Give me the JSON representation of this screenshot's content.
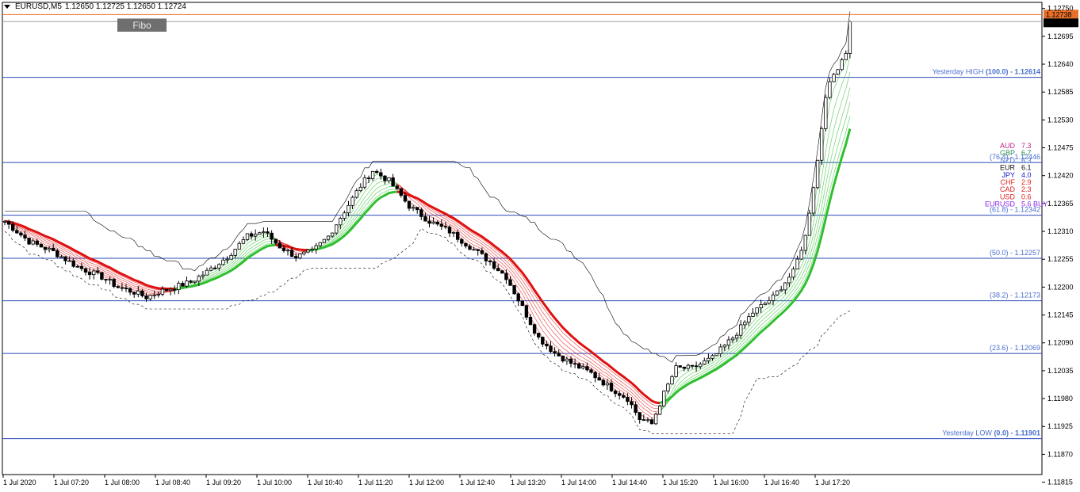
{
  "header": {
    "symbol": "EURUSD,M5",
    "ohlc": "1.12650 1.12725 1.12650 1.12724"
  },
  "fibo_button": "Fibo",
  "price_tags": {
    "ask": "1.12738",
    "bid": "1.12724",
    "ask_color": "#e8702a",
    "bid_color": "#000000"
  },
  "currency_strength": [
    {
      "cur": "AUD",
      "val": "7.3",
      "color": "#c0248c"
    },
    {
      "cur": "GBP",
      "val": "6.7",
      "color": "#2e8b57"
    },
    {
      "cur": "NZD",
      "val": "6.3",
      "color": "#4a6fd0"
    },
    {
      "cur": "EUR",
      "val": "6.1",
      "color": "#111111"
    },
    {
      "cur": "JPY",
      "val": "4.0",
      "color": "#1515c8"
    },
    {
      "cur": "CHF",
      "val": "2.9",
      "color": "#e02020"
    },
    {
      "cur": "CAD",
      "val": "2.3",
      "color": "#e02020"
    },
    {
      "cur": "USD",
      "val": "0.6",
      "color": "#e02020"
    },
    {
      "cur": "EURUSD",
      "val": "5.6 BUY",
      "color": "#8a2be2"
    }
  ],
  "chart_data": {
    "type": "candlestick",
    "symbol": "EURUSD",
    "timeframe": "M5",
    "y_range": [
      1.1183,
      1.12762
    ],
    "y_ticks": [
      "1.12750",
      "1.12695",
      "1.12640",
      "1.12585",
      "1.12530",
      "1.12475",
      "1.12420",
      "1.12365",
      "1.12310",
      "1.12255",
      "1.12200",
      "1.12145",
      "1.12090",
      "1.12035",
      "1.11980",
      "1.11925",
      "1.11870",
      "1.11815"
    ],
    "x_ticks": [
      "1 Jul 2020",
      "1 Jul 07:20",
      "1 Jul 08:00",
      "1 Jul 08:40",
      "1 Jul 09:20",
      "1 Jul 10:00",
      "1 Jul 10:40",
      "1 Jul 11:20",
      "1 Jul 12:00",
      "1 Jul 12:40",
      "1 Jul 13:20",
      "1 Jul 14:00",
      "1 Jul 14:40",
      "1 Jul 15:20",
      "1 Jul 16:00",
      "1 Jul 16:40",
      "1 Jul 17:20"
    ],
    "fib_levels": [
      {
        "label": "Yesterday HIGH",
        "pct": "(100.0)",
        "price": "1.12614",
        "value": 1.12614
      },
      {
        "label": "",
        "pct": "(76.4)",
        "price": "1.12446",
        "value": 1.12446
      },
      {
        "label": "",
        "pct": "(61.8)",
        "price": "1.12342",
        "value": 1.12342
      },
      {
        "label": "",
        "pct": "(50.0)",
        "price": "1.12257",
        "value": 1.12257
      },
      {
        "label": "",
        "pct": "(38.2)",
        "price": "1.12173",
        "value": 1.12173
      },
      {
        "label": "",
        "pct": "(23.6)",
        "price": "1.12069",
        "value": 1.12069
      },
      {
        "label": "Yesterday LOW",
        "pct": "(0.0)",
        "price": "1.11901",
        "value": 1.11901
      }
    ],
    "ask": 1.12738,
    "bid": 1.12724,
    "path_points": [
      [
        0,
        1.1233
      ],
      [
        6,
        1.1229
      ],
      [
        12,
        1.1227
      ],
      [
        18,
        1.1224
      ],
      [
        24,
        1.1222
      ],
      [
        28,
        1.122
      ],
      [
        32,
        1.1219
      ],
      [
        35,
        1.1218
      ],
      [
        38,
        1.1219
      ],
      [
        42,
        1.122
      ],
      [
        46,
        1.1221
      ],
      [
        50,
        1.1223
      ],
      [
        55,
        1.1226
      ],
      [
        60,
        1.123
      ],
      [
        64,
        1.1231
      ],
      [
        68,
        1.1228
      ],
      [
        72,
        1.1226
      ],
      [
        76,
        1.1227
      ],
      [
        80,
        1.123
      ],
      [
        84,
        1.1235
      ],
      [
        88,
        1.124
      ],
      [
        91,
        1.1243
      ],
      [
        95,
        1.1241
      ],
      [
        100,
        1.1236
      ],
      [
        105,
        1.1233
      ],
      [
        110,
        1.1231
      ],
      [
        115,
        1.1228
      ],
      [
        120,
        1.1225
      ],
      [
        124,
        1.1222
      ],
      [
        128,
        1.1216
      ],
      [
        132,
        1.121
      ],
      [
        136,
        1.1207
      ],
      [
        140,
        1.1205
      ],
      [
        145,
        1.1203
      ],
      [
        150,
        1.12
      ],
      [
        154,
        1.1198
      ],
      [
        157,
        1.1194
      ],
      [
        160,
        1.1193
      ],
      [
        163,
        1.1199
      ],
      [
        166,
        1.1204
      ],
      [
        170,
        1.1204
      ],
      [
        175,
        1.1206
      ],
      [
        180,
        1.121
      ],
      [
        185,
        1.1215
      ],
      [
        190,
        1.1218
      ],
      [
        195,
        1.1223
      ],
      [
        198,
        1.123
      ],
      [
        201,
        1.1245
      ],
      [
        203,
        1.1258
      ],
      [
        205,
        1.1262
      ],
      [
        207,
        1.1265
      ],
      [
        209,
        1.1268
      ]
    ]
  }
}
